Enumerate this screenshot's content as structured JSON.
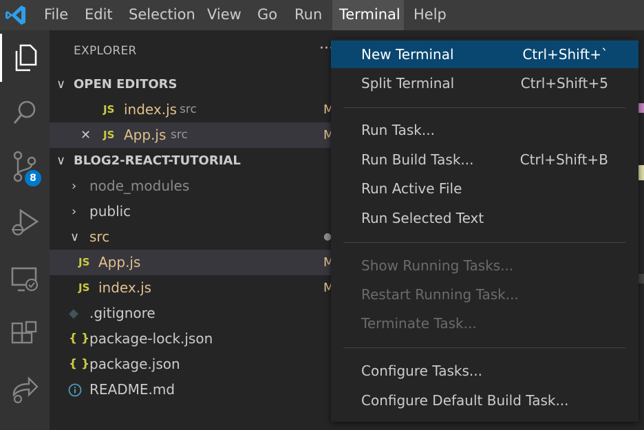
{
  "menubar": {
    "logo_icon": "vscode-logo-icon",
    "items": [
      "File",
      "Edit",
      "Selection",
      "View",
      "Go",
      "Run",
      "Terminal",
      "Help"
    ],
    "active_item": "Terminal"
  },
  "activitybar": {
    "icons": [
      "files-icon",
      "search-icon",
      "source-control-icon",
      "run-debug-icon",
      "remote-explorer-icon",
      "extensions-icon",
      "live-share-icon"
    ],
    "source_control_badge": "8"
  },
  "explorer": {
    "title": "EXPLORER",
    "more": "···",
    "open_editors": {
      "header": "OPEN EDITORS",
      "items": [
        {
          "icon": "JS",
          "name": "index.js",
          "folder": "src",
          "status": "M"
        },
        {
          "icon": "JS",
          "name": "App.js",
          "folder": "src",
          "status": "M",
          "close": "✕"
        }
      ]
    },
    "project": {
      "header": "BLOG2-REACT-TUTORIAL",
      "items": [
        {
          "name": "node_modules"
        },
        {
          "name": "public"
        },
        {
          "name": "src"
        },
        {
          "icon": "JS",
          "name": "App.js",
          "status": "M"
        },
        {
          "icon": "JS",
          "name": "index.js",
          "status": "M"
        },
        {
          "name": ".gitignore"
        },
        {
          "icon": "{ }",
          "name": "package-lock.json"
        },
        {
          "icon": "{ }",
          "name": "package.json"
        },
        {
          "name": "README.md"
        }
      ]
    }
  },
  "terminal_menu": {
    "groups": [
      [
        {
          "label": "New Terminal",
          "shortcut": "Ctrl+Shift+`"
        },
        {
          "label": "Split Terminal",
          "shortcut": "Ctrl+Shift+5"
        }
      ],
      [
        {
          "label": "Run Task...",
          "shortcut": ""
        },
        {
          "label": "Run Build Task...",
          "shortcut": "Ctrl+Shift+B"
        },
        {
          "label": "Run Active File",
          "shortcut": ""
        },
        {
          "label": "Run Selected Text",
          "shortcut": ""
        }
      ],
      [
        {
          "label": "Show Running Tasks...",
          "shortcut": "",
          "disabled": true
        },
        {
          "label": "Restart Running Task...",
          "shortcut": "",
          "disabled": true
        },
        {
          "label": "Terminate Task...",
          "shortcut": "",
          "disabled": true
        }
      ],
      [
        {
          "label": "Configure Tasks...",
          "shortcut": ""
        },
        {
          "label": "Configure Default Build Task...",
          "shortcut": ""
        }
      ]
    ]
  },
  "colors": {
    "menu_highlight": "#094771",
    "accent": "#007acc",
    "modified": "#e2c08d",
    "js_icon": "#cbcb41"
  }
}
